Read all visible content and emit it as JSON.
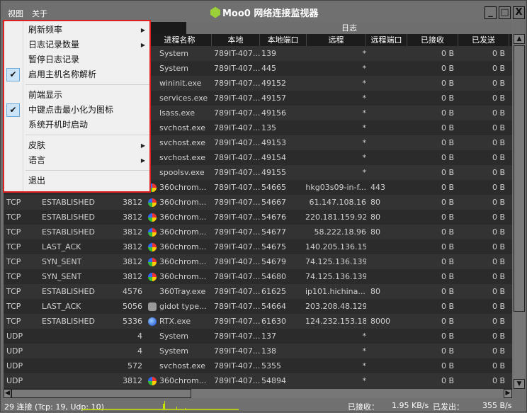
{
  "menubar": {
    "view": "视图",
    "about": "关于"
  },
  "window": {
    "title": "Moo0 网络连接监视器",
    "minimize": "_",
    "maximize": "□",
    "close": "X"
  },
  "tabs": {
    "log": "日志"
  },
  "columns": [
    "进程名称",
    "本地",
    "本地端口",
    "远程",
    "远程端口",
    "已接收",
    "已发送"
  ],
  "rows": [
    {
      "proto": "",
      "state": "",
      "pid": "",
      "icon": "",
      "name": "System",
      "local": "789IT-407...",
      "lport": "139",
      "remote": "*",
      "rport": "",
      "recv": "0 B",
      "sent": "0 B"
    },
    {
      "proto": "",
      "state": "",
      "pid": "",
      "icon": "",
      "name": "System",
      "local": "789IT-407...",
      "lport": "445",
      "remote": "*",
      "rport": "",
      "recv": "0 B",
      "sent": "0 B"
    },
    {
      "proto": "",
      "state": "",
      "pid": "",
      "icon": "",
      "name": "wininit.exe",
      "local": "789IT-407...",
      "lport": "49152",
      "remote": "*",
      "rport": "",
      "recv": "0 B",
      "sent": "0 B"
    },
    {
      "proto": "",
      "state": "",
      "pid": "",
      "icon": "",
      "name": "services.exe",
      "local": "789IT-407...",
      "lport": "49157",
      "remote": "*",
      "rport": "",
      "recv": "0 B",
      "sent": "0 B"
    },
    {
      "proto": "",
      "state": "",
      "pid": "",
      "icon": "",
      "name": "lsass.exe",
      "local": "789IT-407...",
      "lport": "49156",
      "remote": "*",
      "rport": "",
      "recv": "0 B",
      "sent": "0 B"
    },
    {
      "proto": "",
      "state": "",
      "pid": "",
      "icon": "",
      "name": "svchost.exe",
      "local": "789IT-407...",
      "lport": "135",
      "remote": "*",
      "rport": "",
      "recv": "0 B",
      "sent": "0 B"
    },
    {
      "proto": "",
      "state": "",
      "pid": "",
      "icon": "",
      "name": "svchost.exe",
      "local": "789IT-407...",
      "lport": "49153",
      "remote": "*",
      "rport": "",
      "recv": "0 B",
      "sent": "0 B"
    },
    {
      "proto": "",
      "state": "",
      "pid": "",
      "icon": "",
      "name": "svchost.exe",
      "local": "789IT-407...",
      "lport": "49154",
      "remote": "*",
      "rport": "",
      "recv": "0 B",
      "sent": "0 B"
    },
    {
      "proto": "",
      "state": "",
      "pid": "",
      "icon": "",
      "name": "spoolsv.exe",
      "local": "789IT-407...",
      "lport": "49155",
      "remote": "*",
      "rport": "",
      "recv": "0 B",
      "sent": "0 B"
    },
    {
      "proto": "",
      "state": "",
      "pid": "",
      "icon": "360",
      "name": "360chrom...",
      "local": "789IT-407...",
      "lport": "54665",
      "remote": "hkg03s09-in-f...",
      "rport": "443",
      "recv": "0 B",
      "sent": "0 B"
    },
    {
      "proto": "TCP",
      "state": "ESTABLISHED",
      "pid": "3812",
      "icon": "360",
      "name": "360chrom...",
      "local": "789IT-407...",
      "lport": "54667",
      "remote": "61.147.108.16",
      "rport": "80",
      "recv": "0 B",
      "sent": "0 B"
    },
    {
      "proto": "TCP",
      "state": "ESTABLISHED",
      "pid": "3812",
      "icon": "360",
      "name": "360chrom...",
      "local": "789IT-407...",
      "lport": "54676",
      "remote": "220.181.159.92",
      "rport": "80",
      "recv": "0 B",
      "sent": "0 B"
    },
    {
      "proto": "TCP",
      "state": "ESTABLISHED",
      "pid": "3812",
      "icon": "360",
      "name": "360chrom...",
      "local": "789IT-407...",
      "lport": "54677",
      "remote": "58.222.18.96",
      "rport": "80",
      "recv": "0 B",
      "sent": "0 B"
    },
    {
      "proto": "TCP",
      "state": "LAST_ACK",
      "pid": "3812",
      "icon": "360",
      "name": "360chrom...",
      "local": "789IT-407...",
      "lport": "54675",
      "remote": "140.205.136.15",
      "rport": "",
      "recv": "0 B",
      "sent": "0 B"
    },
    {
      "proto": "TCP",
      "state": "SYN_SENT",
      "pid": "3812",
      "icon": "360",
      "name": "360chrom...",
      "local": "789IT-407...",
      "lport": "54679",
      "remote": "74.125.136.139",
      "rport": "",
      "recv": "0 B",
      "sent": "0 B"
    },
    {
      "proto": "TCP",
      "state": "SYN_SENT",
      "pid": "3812",
      "icon": "360",
      "name": "360chrom...",
      "local": "789IT-407...",
      "lport": "54680",
      "remote": "74.125.136.139",
      "rport": "",
      "recv": "0 B",
      "sent": "0 B"
    },
    {
      "proto": "TCP",
      "state": "ESTABLISHED",
      "pid": "4576",
      "icon": "",
      "name": "360Tray.exe",
      "local": "789IT-407...",
      "lport": "61625",
      "remote": "ip101.hichina....",
      "rport": "80",
      "recv": "0 B",
      "sent": "0 B"
    },
    {
      "proto": "TCP",
      "state": "LAST_ACK",
      "pid": "5056",
      "icon": "gidot",
      "name": "gidot type...",
      "local": "789IT-407...",
      "lport": "54664",
      "remote": "203.208.48.129",
      "rport": "",
      "recv": "0 B",
      "sent": "0 B"
    },
    {
      "proto": "TCP",
      "state": "ESTABLISHED",
      "pid": "5336",
      "icon": "rtx",
      "name": "RTX.exe",
      "local": "789IT-407...",
      "lport": "61630",
      "remote": "124.232.153.186",
      "rport": "8000",
      "recv": "0 B",
      "sent": "0 B"
    },
    {
      "proto": "UDP",
      "state": "",
      "pid": "4",
      "icon": "",
      "name": "System",
      "local": "789IT-407...",
      "lport": "137",
      "remote": "*",
      "rport": "",
      "recv": "0 B",
      "sent": "0 B"
    },
    {
      "proto": "UDP",
      "state": "",
      "pid": "4",
      "icon": "",
      "name": "System",
      "local": "789IT-407...",
      "lport": "138",
      "remote": "*",
      "rport": "",
      "recv": "0 B",
      "sent": "0 B"
    },
    {
      "proto": "UDP",
      "state": "",
      "pid": "572",
      "icon": "",
      "name": "svchost.exe",
      "local": "789IT-407...",
      "lport": "5355",
      "remote": "*",
      "rport": "",
      "recv": "0 B",
      "sent": "0 B"
    },
    {
      "proto": "UDP",
      "state": "",
      "pid": "3812",
      "icon": "360",
      "name": "360chrom...",
      "local": "789IT-407...",
      "lport": "54894",
      "remote": "*",
      "rport": "",
      "recv": "0 B",
      "sent": "0 B"
    }
  ],
  "context_menu": [
    {
      "label": "刷新频率",
      "submenu": true,
      "checked": false
    },
    {
      "label": "日志记录数量",
      "submenu": true,
      "checked": false
    },
    {
      "label": "暂停日志记录",
      "submenu": false,
      "checked": false
    },
    {
      "label": "启用主机名称解析",
      "submenu": false,
      "checked": true
    },
    {
      "sep": true
    },
    {
      "label": "前端显示",
      "submenu": false,
      "checked": false
    },
    {
      "label": "中键点击最小化为图标",
      "submenu": false,
      "checked": true
    },
    {
      "label": "系统开机时启动",
      "submenu": false,
      "checked": false
    },
    {
      "sep": true
    },
    {
      "label": "皮肤",
      "submenu": true,
      "checked": false
    },
    {
      "label": "语言",
      "submenu": true,
      "checked": false
    },
    {
      "sep": true
    },
    {
      "label": "退出",
      "submenu": false,
      "checked": false
    }
  ],
  "status": {
    "connections": "29 连接 (Tcp: 19, Udp: 10)",
    "received_label": "已接收：",
    "received_value": "1.95 KB/s",
    "sent_label": "已发出：",
    "sent_value": "355 B/s"
  },
  "colors": {
    "graph": "#c8e600",
    "menu_border": "#e02020",
    "accent_logo": "#9cd03a"
  }
}
